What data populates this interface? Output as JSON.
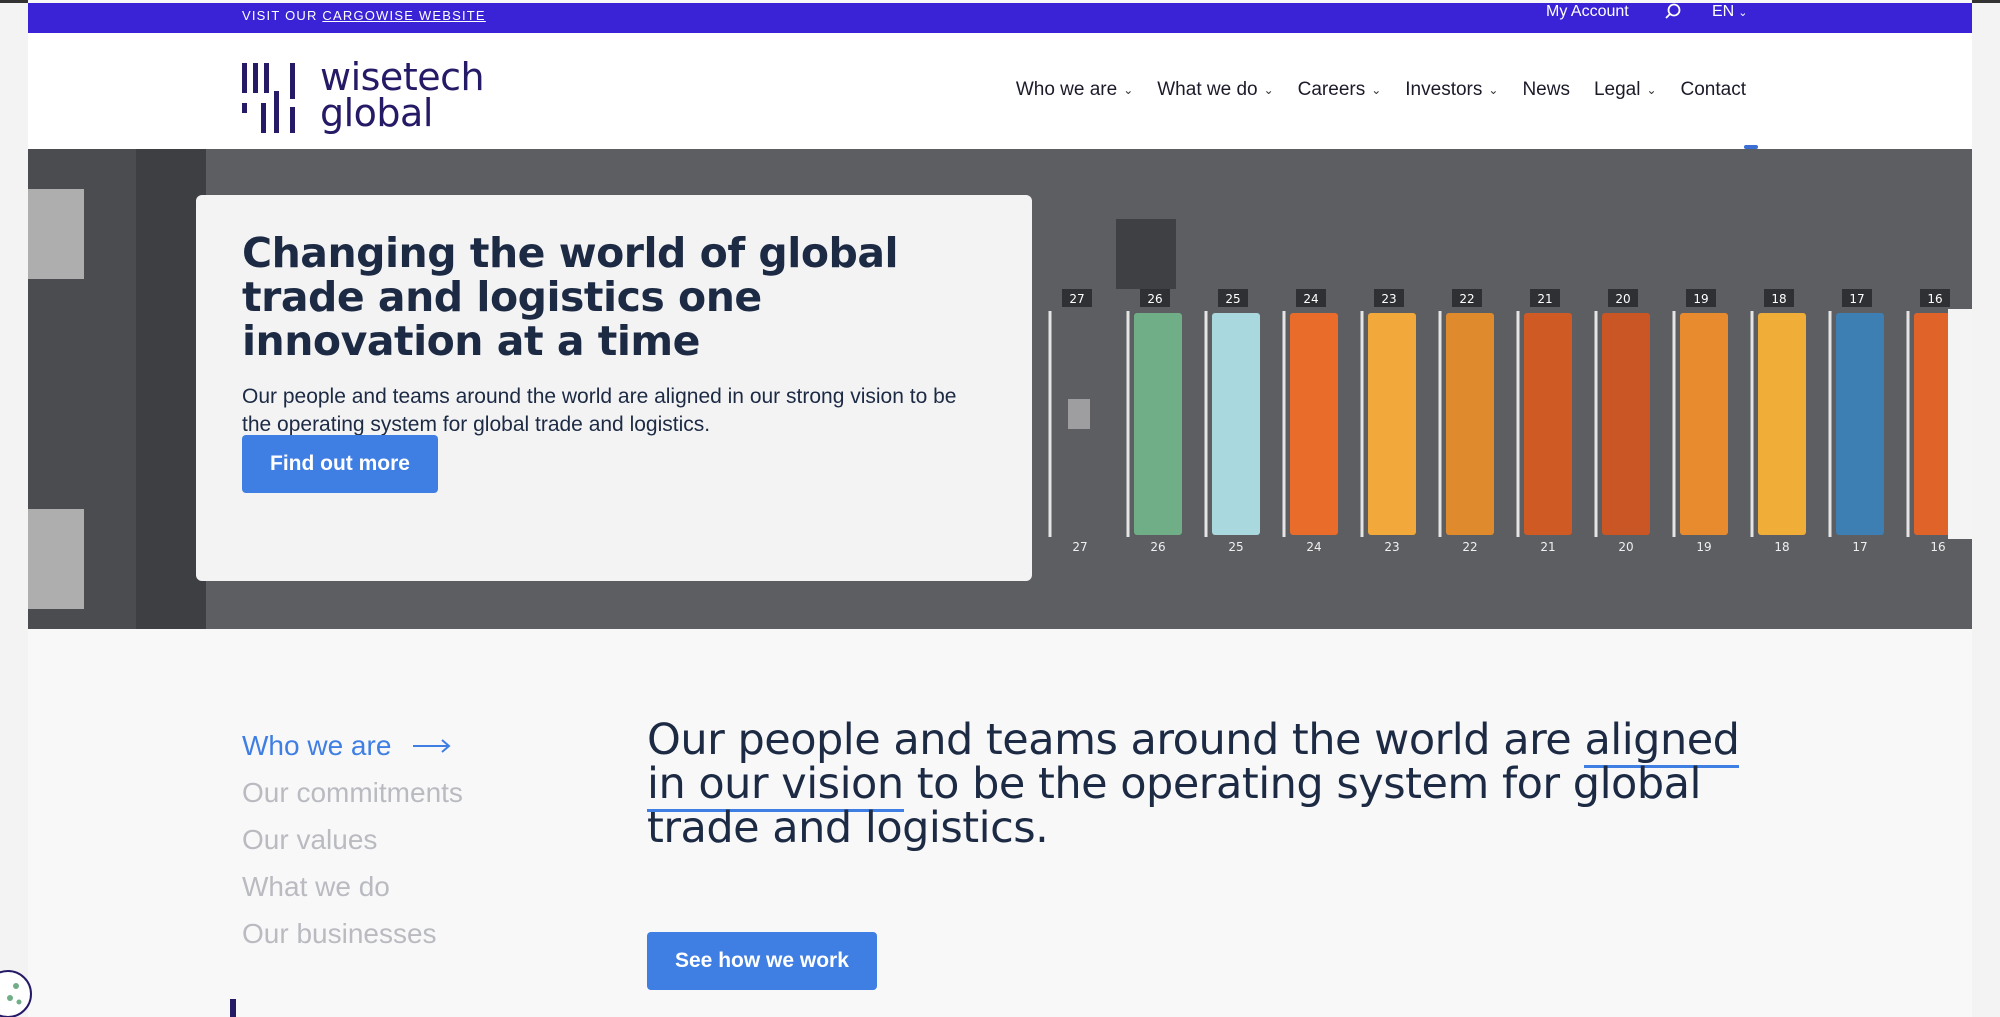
{
  "topbar": {
    "visit_prefix": "VISIT OUR",
    "visit_link": "CARGOWISE WEBSITE",
    "account": "My Account",
    "language": "EN"
  },
  "logo": {
    "line1": "wisetech",
    "line2": "global"
  },
  "nav": {
    "items": [
      {
        "label": "Who we are",
        "dropdown": true
      },
      {
        "label": "What we do",
        "dropdown": true
      },
      {
        "label": "Careers",
        "dropdown": true
      },
      {
        "label": "Investors",
        "dropdown": true
      },
      {
        "label": "News",
        "dropdown": false
      },
      {
        "label": "Legal",
        "dropdown": true
      },
      {
        "label": "Contact",
        "dropdown": false
      }
    ]
  },
  "hero": {
    "title": "Changing the world of global trade and logistics one innovation at a time",
    "subtitle": "Our people and teams around the world are aligned in our strong vision to be the operating system for global trade and logistics.",
    "cta": "Find out more",
    "bay_numbers": [
      "27",
      "26",
      "25",
      "24",
      "23",
      "22",
      "21",
      "20",
      "19",
      "18",
      "17",
      "16"
    ],
    "container_colors": [
      "#ffffff",
      "#6fae86",
      "#a9d9de",
      "#e96c2a",
      "#f2a83a",
      "#e08a2e",
      "#cf5a23",
      "#c95624",
      "#e88b2f",
      "#f0ad38",
      "#3e7fb3",
      "#e0632a"
    ]
  },
  "section": {
    "side_nav": [
      "Who we are",
      "Our commitments",
      "Our values",
      "What we do",
      "Our businesses"
    ],
    "text_before": "Our people and teams around the world are ",
    "text_highlight": "aligned in our vision",
    "text_after": " to be the operating system for global trade and logistics.",
    "cta": "See how we work"
  },
  "colors": {
    "brand_purple": "#3a22d6",
    "accent_blue": "#3f7ee3",
    "navy": "#1c2a44"
  }
}
